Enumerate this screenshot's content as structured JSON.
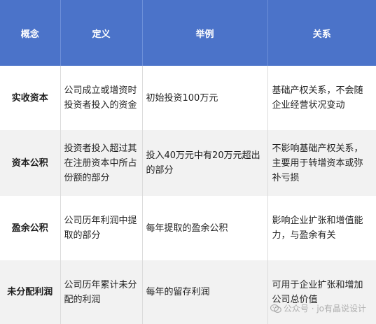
{
  "table": {
    "headers": [
      "概念",
      "定义",
      "举例",
      "关系"
    ],
    "rows": [
      {
        "concept": "实收资本",
        "definition": "公司成立或增资时投资者投入的资金",
        "example": "初始投资100万元",
        "relation": "基础产权关系，不会随企业经营状况变动"
      },
      {
        "concept": "资本公积",
        "definition": "投资者投入超过其在注册资本中所占份额的部分",
        "example": "投入40万元中有20万元超出的部分",
        "relation": "不影响基础产权关系，主要用于转增资本或弥补亏损"
      },
      {
        "concept": "盈余公积",
        "definition": "公司历年利润中提取的部分",
        "example": "每年提取的盈余公积",
        "relation": "影响企业扩张和增值能力，与盈余有关"
      },
      {
        "concept": "未分配利润",
        "definition": "公司历年累计未分配的利润",
        "example": "每年的留存利润",
        "relation": "可用于企业扩张和增加公司总价值"
      }
    ]
  },
  "watermark": {
    "text": "公众号 · jo有晶说设计",
    "icon": "wechat-icon"
  }
}
